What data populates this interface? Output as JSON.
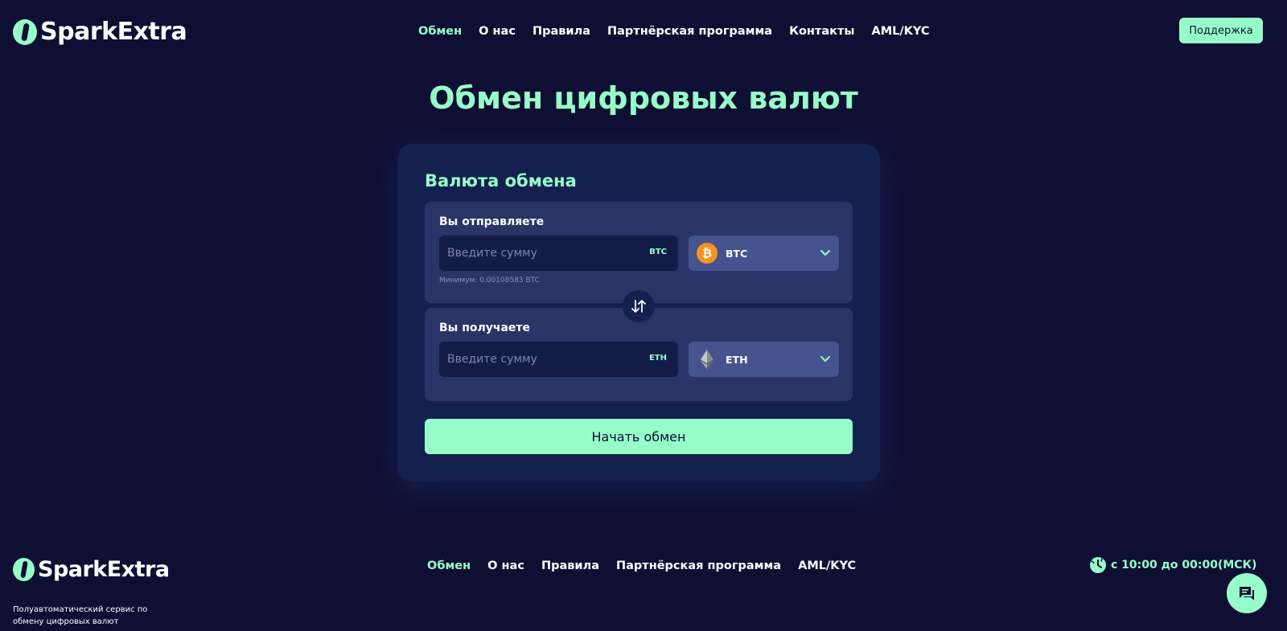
{
  "brand": {
    "name": "SparkExtra",
    "accent_color": "#97fdc8",
    "background_color": "#0e0f33"
  },
  "header": {
    "nav": [
      {
        "label": "Обмен",
        "active": true
      },
      {
        "label": "О нас",
        "active": false
      },
      {
        "label": "Правила",
        "active": false
      },
      {
        "label": "Партнёрская программа",
        "active": false
      },
      {
        "label": "Контакты",
        "active": false
      },
      {
        "label": "AML/KYC",
        "active": false
      }
    ],
    "support_label": "Поддержка"
  },
  "hero": {
    "title": "Обмен цифровых валют"
  },
  "exchange": {
    "title": "Валюта обмена",
    "send": {
      "label": "Вы отправляете",
      "placeholder": "Введите сумму",
      "value": "",
      "unit": "BTC",
      "currency": "BTC",
      "currency_icon": "bitcoin-icon",
      "minimum": "Минимум: 0.00108583 BTC"
    },
    "receive": {
      "label": "Вы получаете",
      "placeholder": "Введите сумму",
      "value": "",
      "unit": "ETH",
      "currency": "ETH",
      "currency_icon": "ethereum-icon"
    },
    "swap_icon": "swap-arrows-icon",
    "start_label": "Начать обмен"
  },
  "footer": {
    "nav": [
      {
        "label": "Обмен",
        "active": true
      },
      {
        "label": "О нас",
        "active": false
      },
      {
        "label": "Правила",
        "active": false
      },
      {
        "label": "Партнёрская программа",
        "active": false
      },
      {
        "label": "AML/KYC",
        "active": false
      }
    ],
    "description": "Полуавтоматический сервис по обмену цифровых валют",
    "hours": "с 10:00 до 00:00(МСК)"
  },
  "chat": {
    "icon": "chat-icon"
  }
}
